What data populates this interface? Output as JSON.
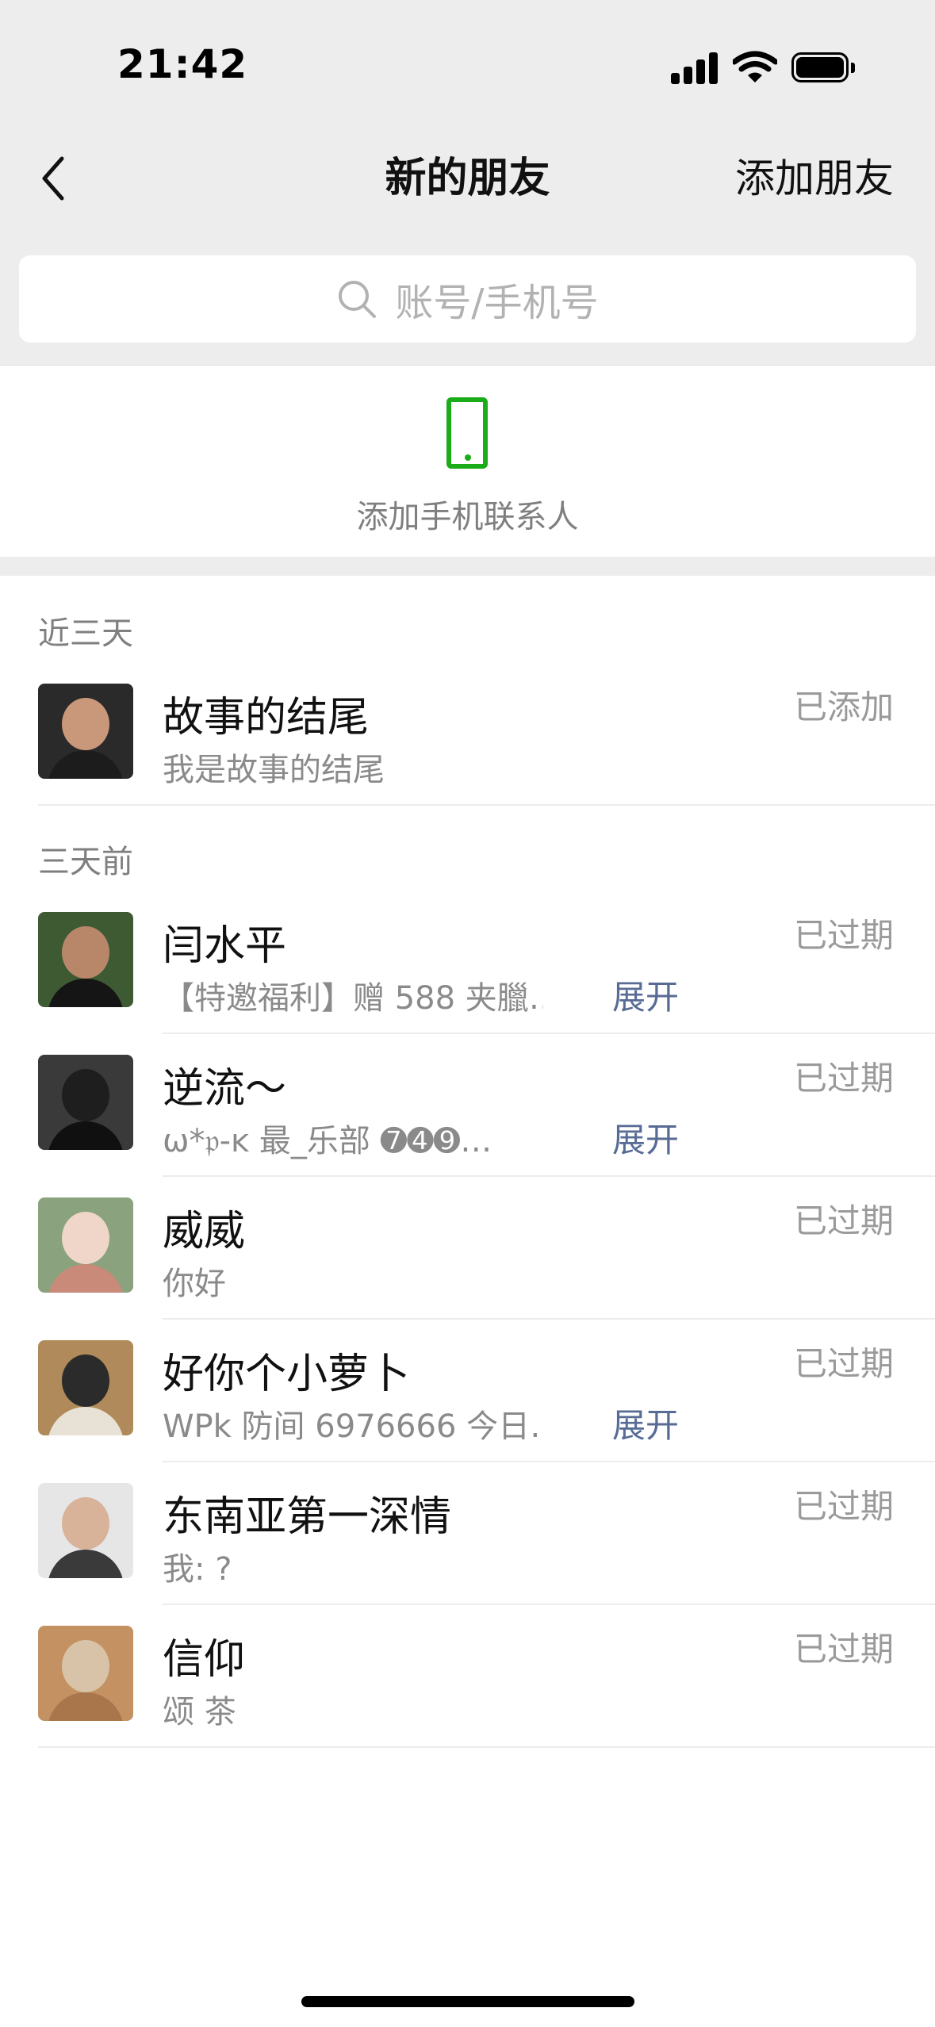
{
  "status_bar": {
    "time": "21:42"
  },
  "nav": {
    "title": "新的朋友",
    "action": "添加朋友"
  },
  "search": {
    "placeholder": "账号/手机号"
  },
  "phone_contacts": {
    "label": "添加手机联系人",
    "icon_color": "#1aad19"
  },
  "sections": [
    {
      "header": "近三天",
      "items": [
        {
          "name": "故事的结尾",
          "subtitle": "我是故事的结尾",
          "status": "已添加"
        }
      ]
    },
    {
      "header": "三天前",
      "items": [
        {
          "name": "闫水平",
          "subtitle": "【特邀福利】赠 588 夹臘…",
          "expand": "展开",
          "status": "已过期"
        },
        {
          "name": "逆流～",
          "subtitle": "ω*𝔭-ĸ 最_乐部 ➐➍➒…",
          "expand": "展开",
          "status": "已过期"
        },
        {
          "name": "威威",
          "subtitle": "你好",
          "status": "已过期"
        },
        {
          "name": "好你个小萝卜",
          "subtitle": "WPk 防间 6976666 今日…",
          "expand": "展开",
          "status": "已过期"
        },
        {
          "name": "东南亚第一深情",
          "subtitle": "我: ?",
          "status": "已过期"
        },
        {
          "name": "信仰",
          "subtitle": "颂 茶",
          "status": "已过期"
        }
      ]
    }
  ],
  "colors": {
    "link": "#576b95",
    "accent": "#1aad19",
    "background": "#ededed"
  }
}
